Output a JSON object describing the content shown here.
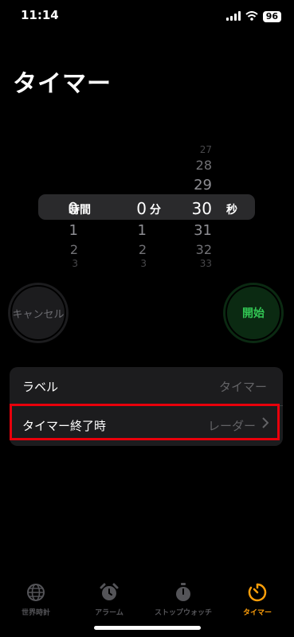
{
  "status_bar": {
    "time": "11:14",
    "battery": "96"
  },
  "page": {
    "title": "タイマー"
  },
  "picker": {
    "hours": {
      "above": [],
      "selected": "0",
      "below": [
        "1",
        "2",
        "3"
      ],
      "unit": "時間"
    },
    "minutes": {
      "above": [],
      "selected": "0",
      "below": [
        "1",
        "2",
        "3"
      ],
      "unit": "分"
    },
    "seconds": {
      "above": [
        "27",
        "28",
        "29"
      ],
      "selected": "30",
      "below": [
        "31",
        "32",
        "33"
      ],
      "unit": "秒"
    }
  },
  "buttons": {
    "cancel": "キャンセル",
    "start": "開始"
  },
  "settings": {
    "label_row": {
      "label": "ラベル",
      "value": "タイマー"
    },
    "end_row": {
      "label": "タイマー終了時",
      "value": "レーダー"
    }
  },
  "tabs": [
    {
      "label": "世界時計",
      "icon": "globe-icon",
      "active": false
    },
    {
      "label": "アラーム",
      "icon": "alarm-clock-icon",
      "active": false
    },
    {
      "label": "ストップウォッチ",
      "icon": "stopwatch-icon",
      "active": false
    },
    {
      "label": "タイマー",
      "icon": "timer-icon",
      "active": true
    }
  ],
  "colors": {
    "accent": "#ff9f0a",
    "start_green": "#32c553",
    "highlight_red": "#e8000b"
  }
}
